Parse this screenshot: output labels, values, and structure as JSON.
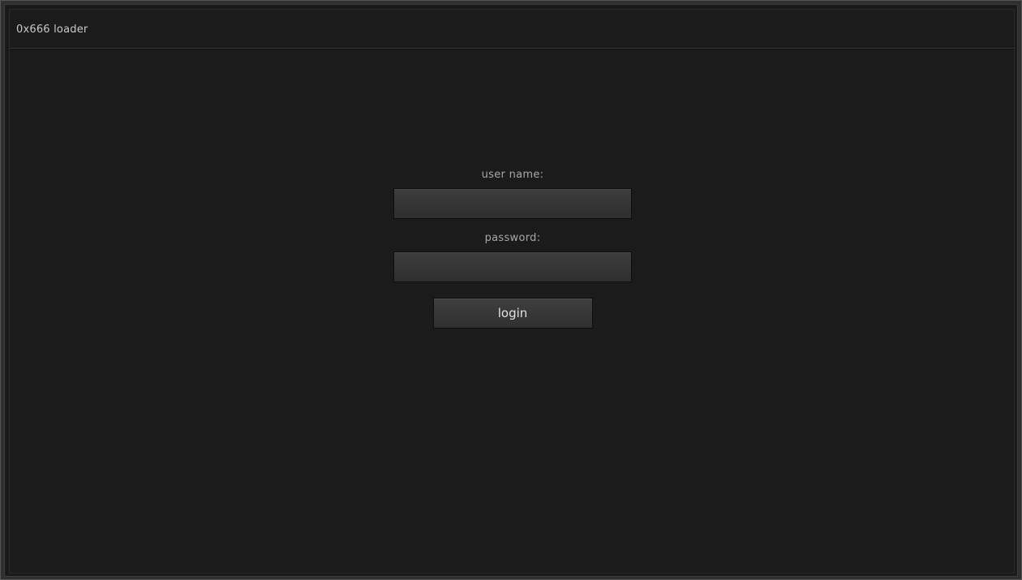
{
  "window": {
    "title": "0x666 loader"
  },
  "login": {
    "username_label": "user name:",
    "username_value": "",
    "password_label": "password:",
    "password_value": "",
    "login_button_label": "login"
  },
  "colors": {
    "background": "#1b1b1b",
    "input_fill": "#363636",
    "label_text": "#a8a8a8",
    "button_text": "#e3e3e3"
  }
}
